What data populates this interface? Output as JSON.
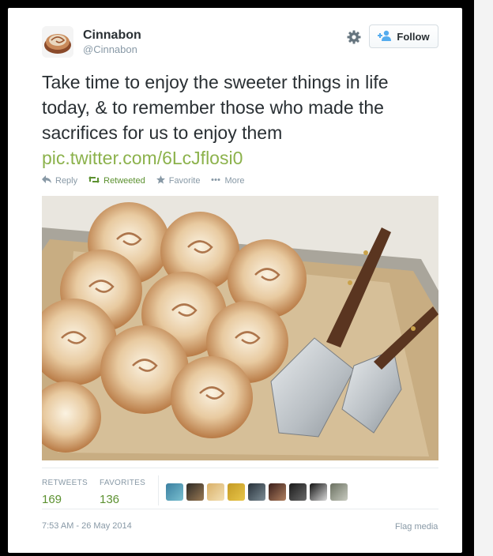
{
  "author": {
    "name": "Cinnabon",
    "handle": "@Cinnabon"
  },
  "follow_label": "Follow",
  "tweet": {
    "text": "Take time to enjoy the sweeter things in life today, & to remember those who made the sacrifices for us to enjoy them",
    "link": "pic.twitter.com/6LcJflosi0"
  },
  "actions": {
    "reply": "Reply",
    "retweeted": "Retweeted",
    "favorite": "Favorite",
    "more": "More"
  },
  "stats": {
    "retweets_label": "RETWEETS",
    "retweets_value": "169",
    "favorites_label": "FAVORITES",
    "favorites_value": "136"
  },
  "favoriters": [
    {
      "colors": [
        "#3a7fa0",
        "#7ac0d0"
      ]
    },
    {
      "colors": [
        "#2d2a25",
        "#9a7a55"
      ]
    },
    {
      "colors": [
        "#d9b068",
        "#f3e0b5"
      ]
    },
    {
      "colors": [
        "#c49a24",
        "#e8c64a"
      ]
    },
    {
      "colors": [
        "#27313a",
        "#7e8d96"
      ]
    },
    {
      "colors": [
        "#3a1e1a",
        "#b08060"
      ]
    },
    {
      "colors": [
        "#1a1a1a",
        "#6a6a6a"
      ]
    },
    {
      "colors": [
        "#111111",
        "#d9d9d9"
      ]
    },
    {
      "colors": [
        "#6a7060",
        "#c8cbc0"
      ]
    }
  ],
  "timestamp": "7:53 AM - 26 May 2014",
  "flag_media": "Flag media",
  "icons": {
    "gear": "gear-icon",
    "follow": "add-user-icon",
    "reply": "reply-icon",
    "retweet": "retweet-icon",
    "favorite": "star-icon",
    "more": "ellipsis-icon"
  },
  "colors": {
    "link_green": "#8cb24c",
    "retweeted_green": "#5c9130",
    "meta_gray": "#8899a6",
    "text_dark": "#292f33"
  }
}
